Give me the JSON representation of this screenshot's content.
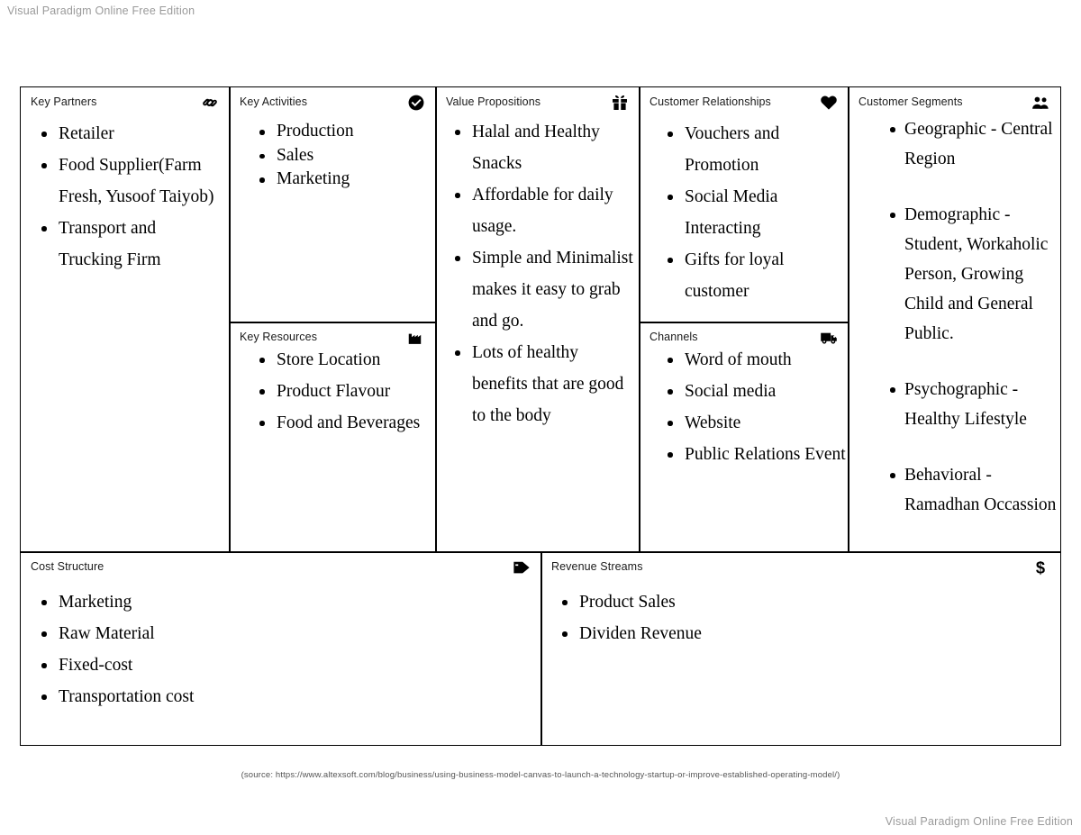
{
  "watermark": {
    "top": "Visual Paradigm Online Free Edition",
    "bottom": "Visual Paradigm Online Free Edition"
  },
  "source_note": "(source: https://www.altexsoft.com/blog/business/using-business-model-canvas-to-launch-a-technology-startup-or-improve-established-operating-model/)",
  "canvas": {
    "blocks": {
      "key_partners": {
        "title": "Key Partners",
        "icon": "chain-link-icon",
        "items": [
          "Retailer",
          "Food Supplier(Farm Fresh, Yusoof Taiyob)",
          "Transport and Trucking  Firm"
        ]
      },
      "key_activities": {
        "title": "Key Activities",
        "icon": "check-circle-icon",
        "items": [
          "Production",
          "Sales",
          "Marketing"
        ]
      },
      "key_resources": {
        "title": "Key Resources",
        "icon": "factory-icon",
        "items": [
          "Store Location",
          "Product Flavour",
          "Food and Beverages"
        ]
      },
      "value_propositions": {
        "title": "Value Propositions",
        "icon": "gift-icon",
        "items": [
          "Halal and Healthy Snacks",
          "Affordable for daily usage.",
          "Simple and Minimalist makes it easy to grab and go.",
          "Lots of healthy benefits that are good to the body"
        ]
      },
      "customer_relationships": {
        "title": "Customer Relationships",
        "icon": "heart-icon",
        "items": [
          "Vouchers and Promotion",
          "Social Media Interacting",
          "Gifts for loyal customer"
        ]
      },
      "channels": {
        "title": "Channels",
        "icon": "truck-icon",
        "items": [
          "Word of mouth",
          "Social media",
          "Website",
          "Public Relations Event"
        ]
      },
      "customer_segments": {
        "title": "Customer Segments",
        "icon": "people-icon",
        "items": [
          "Geographic - Central Region",
          "Demographic - Student, Workaholic Person, Growing Child and General Public.",
          "Psychographic - Healthy Lifestyle",
          "Behavioral - Ramadhan Occassion"
        ]
      },
      "cost_structure": {
        "title": "Cost Structure",
        "icon": "price-tag-icon",
        "items": [
          "Marketing",
          "Raw Material",
          "Fixed-cost",
          "Transportation cost"
        ]
      },
      "revenue_streams": {
        "title": "Revenue Streams",
        "icon": "dollar-sign-icon",
        "items": [
          "Product Sales",
          "Dividen Revenue"
        ]
      }
    }
  },
  "colors": {
    "border": "#000000",
    "text": "#000000",
    "watermark": "#9a9a9a",
    "background": "#ffffff"
  }
}
